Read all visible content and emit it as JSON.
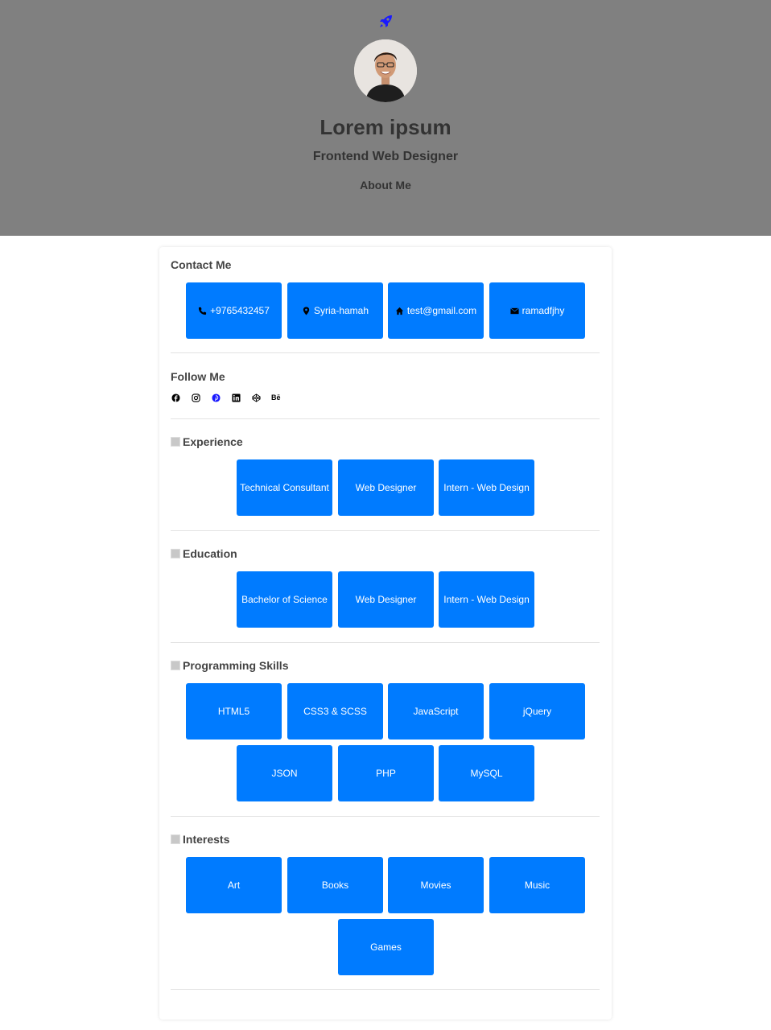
{
  "header": {
    "name": "Lorem ipsum",
    "role": "Frontend Web Designer",
    "about_link": "About Me"
  },
  "contact": {
    "title": "Contact Me",
    "items": [
      {
        "icon": "phone-icon",
        "label": "+9765432457"
      },
      {
        "icon": "map-pin-icon",
        "label": "Syria-hamah"
      },
      {
        "icon": "home-icon",
        "label": "test@gmail.com"
      },
      {
        "icon": "envelope-icon",
        "label": "ramadfjhy"
      }
    ]
  },
  "follow": {
    "title": "Follow Me",
    "icons": [
      "facebook-icon",
      "instagram-icon",
      "pinterest-icon",
      "linkedin-icon",
      "codepen-icon",
      "behance-icon"
    ],
    "behance_text": "Bē"
  },
  "experience": {
    "title": "Experience",
    "items": [
      "Technical Consultant",
      "Web Designer",
      "Intern - Web Design"
    ]
  },
  "education": {
    "title": "Education",
    "items": [
      "Bachelor of Science",
      "Web Designer",
      "Intern - Web Design"
    ]
  },
  "skills": {
    "title": "Programming Skills",
    "items": [
      "HTML5",
      "CSS3 & SCSS",
      "JavaScript",
      "jQuery",
      "JSON",
      "PHP",
      "MySQL"
    ]
  },
  "interests": {
    "title": "Interests",
    "items": [
      "Art",
      "Books",
      "Movies",
      "Music",
      "Games"
    ]
  },
  "colors": {
    "accent": "#007bff",
    "hero_bg": "#808080",
    "rocket": "#1a1aff"
  }
}
